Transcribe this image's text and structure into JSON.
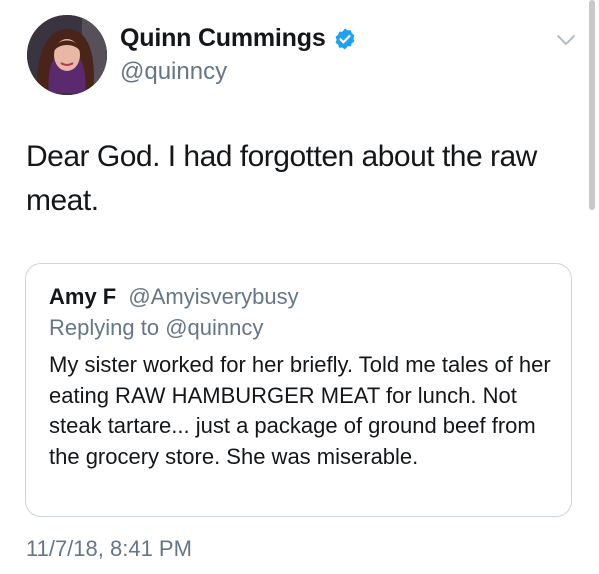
{
  "author": {
    "display_name": "Quinn Cummings",
    "handle": "@quinncy",
    "verified": true
  },
  "tweet": {
    "text": "Dear God. I had forgotten about the raw meat."
  },
  "quoted_tweet": {
    "display_name": "Amy F",
    "handle": "@Amyisverybusy",
    "replying_to_label": "Replying to",
    "replying_to_handle": "@quinncy",
    "text": "My sister worked for her briefly. Told me tales of her eating RAW HAMBURGER MEAT for lunch. Not steak tartare... just a package of ground beef from the grocery store. She was miserable."
  },
  "timestamp": "11/7/18, 8:41 PM",
  "icons": {
    "verified": "verified-badge-icon",
    "menu": "chevron-down-icon"
  },
  "colors": {
    "text_primary": "#14171a",
    "text_secondary": "#657786",
    "verified_blue": "#1da1f2",
    "border": "#ccd6dd"
  }
}
